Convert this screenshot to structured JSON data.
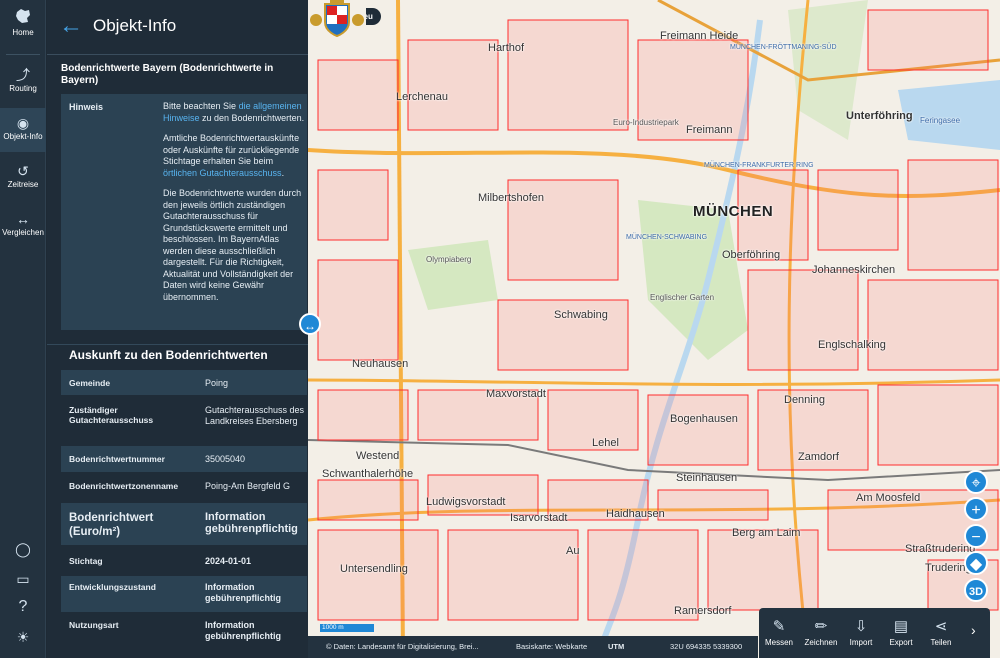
{
  "rail": {
    "items": [
      {
        "label": "Home",
        "icon": "bavaria-map-icon"
      },
      {
        "label": "Routing",
        "icon": "routing-icon"
      },
      {
        "label": "Objekt-Info",
        "icon": "objekt-info-icon"
      },
      {
        "label": "Zeitreise",
        "icon": "history-icon"
      },
      {
        "label": "Vergleichen",
        "icon": "compare-icon"
      }
    ],
    "bottom_icons": [
      "user-icon",
      "feedback-icon",
      "help-icon",
      "settings-icon"
    ]
  },
  "panel": {
    "title": "Objekt-Info",
    "section_title": "Bodenrichtwerte Bayern (Bodenrichtwerte in Bayern)",
    "hint": {
      "label": "Hinweis",
      "p1_before": "Bitte beachten Sie ",
      "p1_link": "die allgemeinen Hinweise",
      "p1_after": " zu den Bodenrichtwerten.",
      "p2_before": "Amtliche Bodenrichtwertauskünfte oder Auskünfte für zurückliegende Stichtage erhalten Sie beim ",
      "p2_link": "örtlichen Gutachterausschuss",
      "p2_after": ".",
      "p3": "Die Bodenrichtwerte wurden durch den jeweils örtlich zuständigen Gutachterausschuss für Grundstückswerte ermittelt und beschlossen. Im BayernAtlas werden diese ausschließlich dargestellt. Für die Richtigkeit, Aktualität und Vollständigkeit der Daten wird keine Gewähr übernommen."
    },
    "auskunft_title": "Auskunft zu den Bodenrichtwerten",
    "rows": [
      {
        "key": "Gemeinde",
        "value": "Poing"
      },
      {
        "key": "Zuständiger Gutachterausschuss",
        "value": "Gutachterausschuss des Landkreises Ebersberg"
      },
      {
        "key": "Bodenrichtwertnummer",
        "value": "35005040"
      },
      {
        "key": "Bodenrichtwertzonenname",
        "value": "Poing-Am Bergfeld G"
      },
      {
        "key": "Bodenrichtwert (Euro/m²)",
        "value": "Information gebührenpflichtig"
      },
      {
        "key": "Stichtag",
        "value": "2024-01-01"
      },
      {
        "key": "Entwicklungszustand",
        "value": "Information gebührenpflichtig"
      },
      {
        "key": "Nutzungsart",
        "value": "Information gebührenpflichtig"
      }
    ]
  },
  "map": {
    "news_button": "Jetzt neu",
    "labels": {
      "muenchen": "MÜNCHEN",
      "harthof": "Harthof",
      "freimann_heide": "Freimann Heide",
      "lerchenau": "Lerchenau",
      "euro_industriepark": "Euro-Industriepark",
      "freimann": "Freimann",
      "unterfoehring": "Unterföhring",
      "feringasee": "Feringasee",
      "muenchen_froettmaning": "MÜNCHEN-FRÖTTMANING-SÜD",
      "muenchen_frankfurter_ring": "MÜNCHEN-FRANKFURTER RING",
      "milbertshofen": "Milbertshofen",
      "olympiaberg": "Olympiaberg",
      "muenchen_schwabing": "MÜNCHEN-SCHWABING",
      "oberfoehring": "Oberföhring",
      "johanneskirchen": "Johanneskirchen",
      "englischer_garten": "Englischer Garten",
      "schwabing": "Schwabing",
      "englschalking": "Englschalking",
      "neuhausen": "Neuhausen",
      "maxvorstadt": "Maxvorstadt",
      "denning": "Denning",
      "lehel": "Lehel",
      "bogenhausen": "Bogenhausen",
      "westend": "Westend",
      "zamdorf": "Zamdorf",
      "schwanthalerhoehe": "Schwanthalerhöhe",
      "steinhausen": "Steinhausen",
      "ludwigsvorstadt": "Ludwigsvorstadt",
      "am_moosfeld": "Am Moosfeld",
      "isarvorstadt": "Isarvorstadt",
      "haidhausen": "Haidhausen",
      "berg_am_laim": "Berg am Laim",
      "au": "Au",
      "untersendling": "Untersendling",
      "strassentrudering": "Straßtrudering",
      "trudering": "Trudering",
      "ramersdorf": "Ramersdorf"
    },
    "scale": "1000 m",
    "footer": {
      "copyright": "© Daten: Landesamt für Digitalisierung, Brei...",
      "basemap": "Basiskarte: Webkarte",
      "crs": "UTM",
      "coords": "32U 694335 5339300"
    },
    "controls": [
      "locate-icon",
      "zoom-in-icon",
      "zoom-out-icon",
      "bavaria-extent-icon",
      "3D"
    ],
    "tools": [
      {
        "label": "Messen",
        "icon": "ruler-icon"
      },
      {
        "label": "Zeichnen",
        "icon": "pencil-icon"
      },
      {
        "label": "Import",
        "icon": "import-icon"
      },
      {
        "label": "Export",
        "icon": "pdf-export-icon"
      },
      {
        "label": "Teilen",
        "icon": "share-icon"
      }
    ],
    "colors": {
      "parcel": "#ff2d2d",
      "road_major": "#f6b041",
      "water": "#b9d8ef",
      "park": "#d5e8c1",
      "accent": "#1f88d6"
    }
  }
}
